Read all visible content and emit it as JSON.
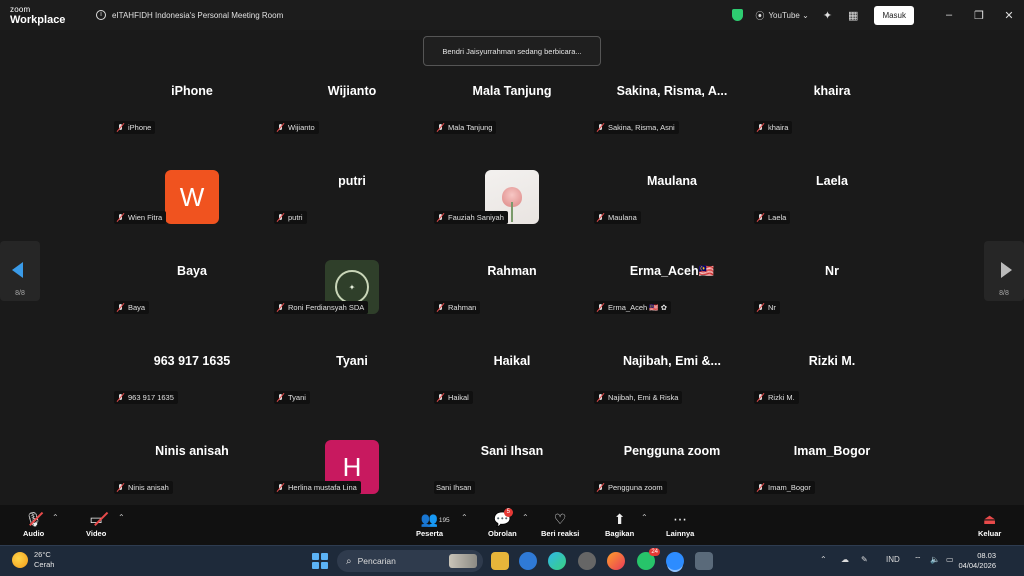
{
  "titlebar": {
    "brand_line1": "zoom",
    "brand_line2": "Workplace",
    "info_icon": "i",
    "window_title": "eITAHFIDH Indonesia's Personal Meeting Room",
    "youtube_label": "YouTube",
    "login_label": "Masuk"
  },
  "toast": {
    "text": "Bendri Jaisyurrahman sedang berbicara..."
  },
  "tiles": [
    {
      "name": "iPhone",
      "label": "iPhone"
    },
    {
      "name": "Wijianto",
      "label": "Wijianto"
    },
    {
      "name": "Mala Tanjung",
      "label": "Mala Tanjung"
    },
    {
      "name": "Sakina, Risma, A...",
      "label": "Sakina, Risma, Asni"
    },
    {
      "name": "khaira",
      "label": "khaira"
    },
    {
      "name": "",
      "avatar_letter": "W",
      "avatar_color": "#f0531f",
      "label": "Wien Fitra"
    },
    {
      "name": "putri",
      "label": "putri"
    },
    {
      "name": "",
      "avatar_image": "rose-photo",
      "label": "Fauziah Saniyah"
    },
    {
      "name": "Maulana",
      "label": "Maulana"
    },
    {
      "name": "Laela",
      "label": "Laela"
    },
    {
      "name": "Baya",
      "label": "Baya"
    },
    {
      "name": "",
      "avatar_image": "green-logo",
      "label": "Roni Ferdiansyah SDA"
    },
    {
      "name": "Rahman",
      "label": "Rahman"
    },
    {
      "name": "Erma_Aceh🇲🇾",
      "label": "Erma_Aceh 🇲🇾 ✿"
    },
    {
      "name": "Nr",
      "label": "Nr"
    },
    {
      "name": "963 917 1635",
      "label": "963 917 1635"
    },
    {
      "name": "Tyani",
      "label": "Tyani"
    },
    {
      "name": "Haikal",
      "label": "Haikal"
    },
    {
      "name": "Najibah, Emi &...",
      "label": "Najibah, Emi & Riska"
    },
    {
      "name": "Rizki M.",
      "label": "Rizki M."
    },
    {
      "name": "Ninis  anisah",
      "label": "Ninis  anisah"
    },
    {
      "name": "",
      "avatar_letter": "H",
      "avatar_color": "#c8195f",
      "label": "Herlina mustafa Lina"
    },
    {
      "name": "Sani Ihsan",
      "label": "Sani Ihsan",
      "mic_muted": false
    },
    {
      "name": "Pengguna zoom",
      "label": "Pengguna zoom"
    },
    {
      "name": "Imam_Bogor",
      "label": "Imam_Bogor"
    }
  ],
  "pager": {
    "left": "8/8",
    "right": "8/8"
  },
  "toolbar": {
    "audio": "Audio",
    "video": "Video",
    "participants": "Peserta",
    "participants_count": "195",
    "chat": "Obrolan",
    "chat_badge": "5",
    "reactions": "Beri reaksi",
    "share": "Bagikan",
    "more": "Lainnya",
    "leave": "Keluar"
  },
  "taskbar": {
    "temp": "26°C",
    "weather": "Cerah",
    "search_placeholder": "Pencarian",
    "whatsapp_badge": "24",
    "lang": "IND",
    "time": "08.03",
    "date": "04/04/2026"
  },
  "colors": {
    "accent_blue": "#3a9be8",
    "muted_red": "#e84a4a",
    "toolbar_bg": "#111111"
  }
}
